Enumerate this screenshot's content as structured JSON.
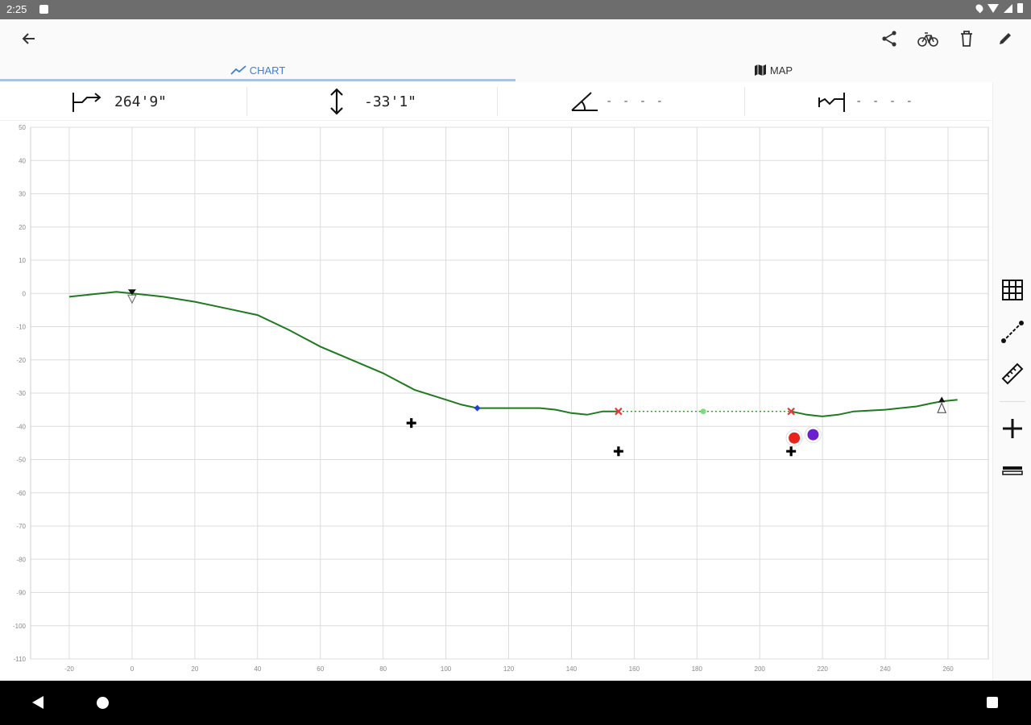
{
  "status_bar": {
    "time": "2:25"
  },
  "tabs": [
    {
      "label": "CHART"
    },
    {
      "label": "MAP"
    }
  ],
  "metrics": {
    "distance": "264'9\"",
    "elevation": "-33'1\"",
    "slope": "- - - -",
    "length": "- - - -"
  },
  "colors": {
    "accent": "#3f7ed8",
    "profile": "#1e7a1e",
    "indicator": "#a9c3e6"
  },
  "chart_data": {
    "type": "line",
    "x_ticks": [
      "-20",
      "0",
      "20",
      "40",
      "60",
      "80",
      "100",
      "120",
      "140",
      "160",
      "180",
      "200",
      "220",
      "240",
      "260"
    ],
    "y_ticks": [
      "50",
      "40",
      "30",
      "20",
      "10",
      "0",
      "-10",
      "-20",
      "-30",
      "-40",
      "-50",
      "-60",
      "-70",
      "-80",
      "-90",
      "-100",
      "-110"
    ],
    "xlim": [
      -20,
      260
    ],
    "ylim": [
      -110,
      50
    ],
    "grid": true,
    "series": [
      {
        "type": "line",
        "x": [
          -20,
          -10,
          -5,
          0,
          5,
          10,
          20,
          30,
          40,
          50,
          60,
          70,
          80,
          85,
          90,
          95,
          100,
          105,
          110,
          115,
          120,
          125,
          130,
          135,
          140,
          145,
          150,
          155
        ],
        "y": [
          -1,
          0,
          0.5,
          0,
          -0.5,
          -1,
          -2.5,
          -4.5,
          -6.5,
          -11,
          -16,
          -20,
          -24,
          -26.5,
          -29,
          -30.5,
          -32,
          -33.5,
          -34.5,
          -34.5,
          -34.5,
          -34.5,
          -34.5,
          -35,
          -36,
          -36.5,
          -35.5,
          -35.5
        ]
      },
      {
        "type": "dotted",
        "x": [
          155,
          210
        ],
        "y": [
          -35.5,
          -35.5
        ]
      },
      {
        "type": "line",
        "x": [
          210,
          215,
          220,
          225,
          230,
          240,
          250,
          255,
          258,
          263
        ],
        "y": [
          -35.5,
          -36.5,
          -37,
          -36.5,
          -35.5,
          -35,
          -34,
          -33,
          -32.5,
          -32
        ]
      }
    ],
    "markers": [
      {
        "x": 0,
        "y": 0,
        "kind": "start-down-triangle",
        "color": "#111111"
      },
      {
        "x": 110,
        "y": -34.5,
        "kind": "diamond",
        "color": "#1f3fd8"
      },
      {
        "x": 155,
        "y": -35.5,
        "kind": "x",
        "color": "#e53935"
      },
      {
        "x": 182,
        "y": -35.5,
        "kind": "dot",
        "color": "#7ddc7d"
      },
      {
        "x": 210,
        "y": -35.5,
        "kind": "x",
        "color": "#e53935"
      },
      {
        "x": 258,
        "y": -32.5,
        "kind": "end-triangle",
        "color": "#111111"
      },
      {
        "x": 89,
        "y": -39,
        "kind": "plus",
        "color": "#000000"
      },
      {
        "x": 155,
        "y": -47.5,
        "kind": "plus",
        "color": "#000000"
      },
      {
        "x": 210,
        "y": -47.5,
        "kind": "plus",
        "color": "#000000"
      },
      {
        "x": 211,
        "y": -43.5,
        "kind": "circle",
        "color": "#e8231c"
      },
      {
        "x": 217,
        "y": -42.5,
        "kind": "circle",
        "color": "#6a1fd1"
      }
    ]
  }
}
